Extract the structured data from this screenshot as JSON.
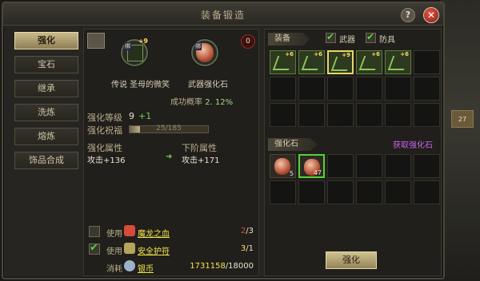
{
  "window": {
    "title": "装备锻造",
    "help": "?",
    "close": "✕"
  },
  "tabs": [
    {
      "label": "强化",
      "active": true
    },
    {
      "label": "宝石",
      "active": false
    },
    {
      "label": "继承",
      "active": false
    },
    {
      "label": "洗炼",
      "active": false
    },
    {
      "label": "熔炼",
      "active": false
    },
    {
      "label": "饰品合成",
      "active": false
    }
  ],
  "enhance": {
    "level_badge": "0",
    "equip_plus": "+9",
    "bind_tag": "绑",
    "equip_name": "传说 圣母的微笑",
    "stone_name": "武器强化石",
    "rate_label": "成功概率",
    "rate_value": "2. 12%",
    "level_label": "强化等级",
    "level_value": "9",
    "level_delta": "+1",
    "bless_label": "强化祝福",
    "bless_text": "25/185",
    "bless_fraction": 0.135,
    "attr_label": "强化属性",
    "next_attr_label": "下阶属性",
    "attr_value": "攻击+136",
    "next_attr_value": "攻击+171"
  },
  "consumables": [
    {
      "checked": false,
      "label": "使用",
      "name": "魔龙之血",
      "have": "2",
      "need": "/3",
      "color": "#d64a3a"
    },
    {
      "checked": true,
      "label": "使用",
      "name": "安全护符",
      "have": "3",
      "need": "/1",
      "color": "#b5a55b"
    },
    {
      "checked": false,
      "label": "消耗",
      "name": "银币",
      "have": "1731158",
      "need": "/18000",
      "color": "#9ab3c9"
    }
  ],
  "right": {
    "equip_header": "装备",
    "filter_weapon": "武器",
    "filter_armor": "防具",
    "stone_header": "强化石",
    "get_stone": "获取强化石",
    "enhance_button": "强化",
    "equip_plus": [
      "+6",
      "+6",
      "+9",
      "+6",
      "+6"
    ],
    "stone_counts": [
      "5",
      "47"
    ]
  },
  "world": {
    "ticket": "27"
  }
}
